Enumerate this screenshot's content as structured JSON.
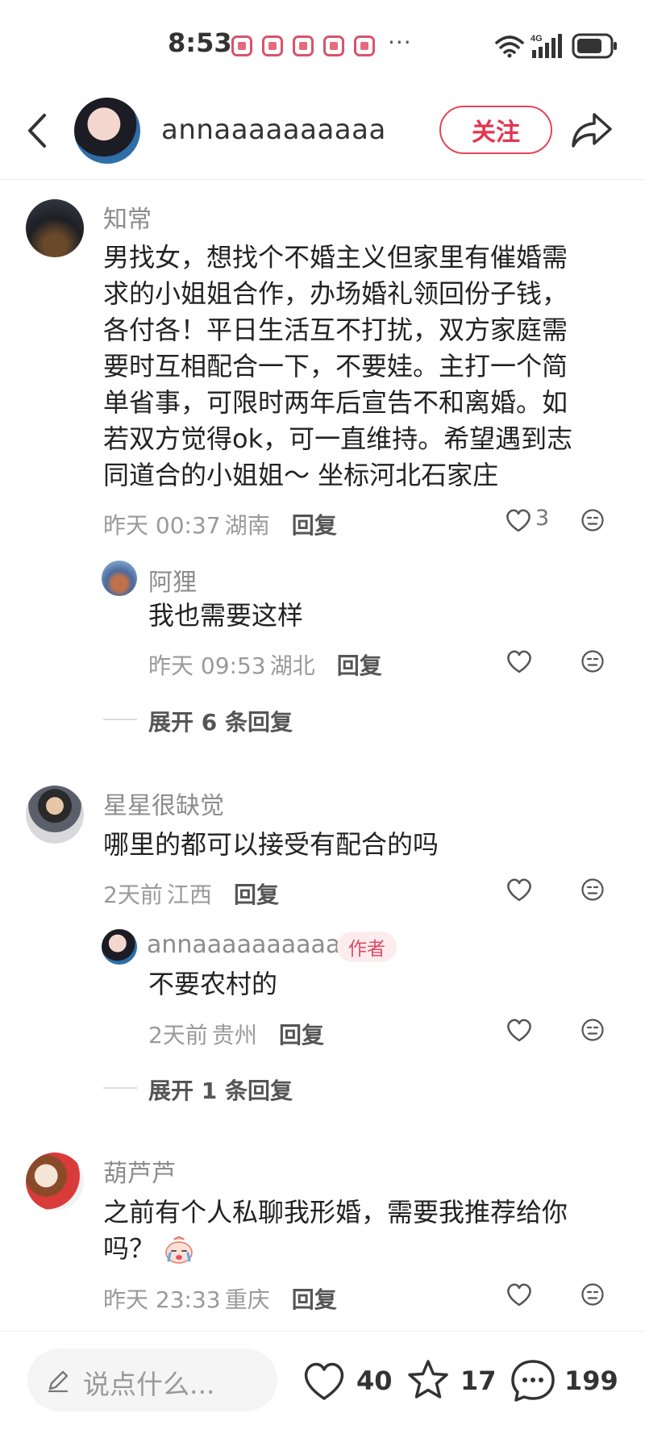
{
  "status_bar": {
    "time": "8:53",
    "dots": "···"
  },
  "header": {
    "author_name": "annaaaaaaaaaa",
    "follow_label": "关注"
  },
  "comments": [
    {
      "username": "知常",
      "text_lines": [
        "男找女，想找个不婚主义但家里有催婚需",
        "求的小姐姐合作，办场婚礼领回份子钱，",
        "各付各！平日生活互不打扰，双方家庭需",
        "要时互相配合一下，不要娃。主打一个简",
        "单省事，可限时两年后宣告不和离婚。如",
        "若双方觉得ok，可一直维持。希望遇到志",
        "同道合的小姐姐～ 坐标河北石家庄"
      ],
      "time": "昨天 00:37",
      "location": "湖南",
      "reply_label": "回复",
      "likes": "3",
      "reply": {
        "username": "阿狸",
        "text": "我也需要这样",
        "time": "昨天 09:53",
        "location": "湖北",
        "reply_label": "回复"
      },
      "expand_label": "展开 6 条回复"
    },
    {
      "username": "星星很缺觉",
      "text": "哪里的都可以接受有配合的吗",
      "time": "2天前",
      "location": "江西",
      "reply_label": "回复",
      "reply": {
        "username": "annaaaaaaaaaa",
        "author_tag": "作者",
        "text": "不要农村的",
        "time": "2天前",
        "location": "贵州",
        "reply_label": "回复"
      },
      "expand_label": "展开 1 条回复"
    },
    {
      "username": "葫芦芦",
      "text_lines": [
        "之前有个人私聊我形婚，需要我推荐给你",
        "吗？"
      ],
      "time": "昨天 23:33",
      "location": "重庆",
      "reply_label": "回复"
    }
  ],
  "bottom_bar": {
    "input_placeholder": "说点什么...",
    "like_count": "40",
    "collect_count": "17",
    "comment_count": "199"
  },
  "colors": {
    "accent": "#e23650",
    "text": "#222222",
    "muted": "#9a9a9a"
  }
}
